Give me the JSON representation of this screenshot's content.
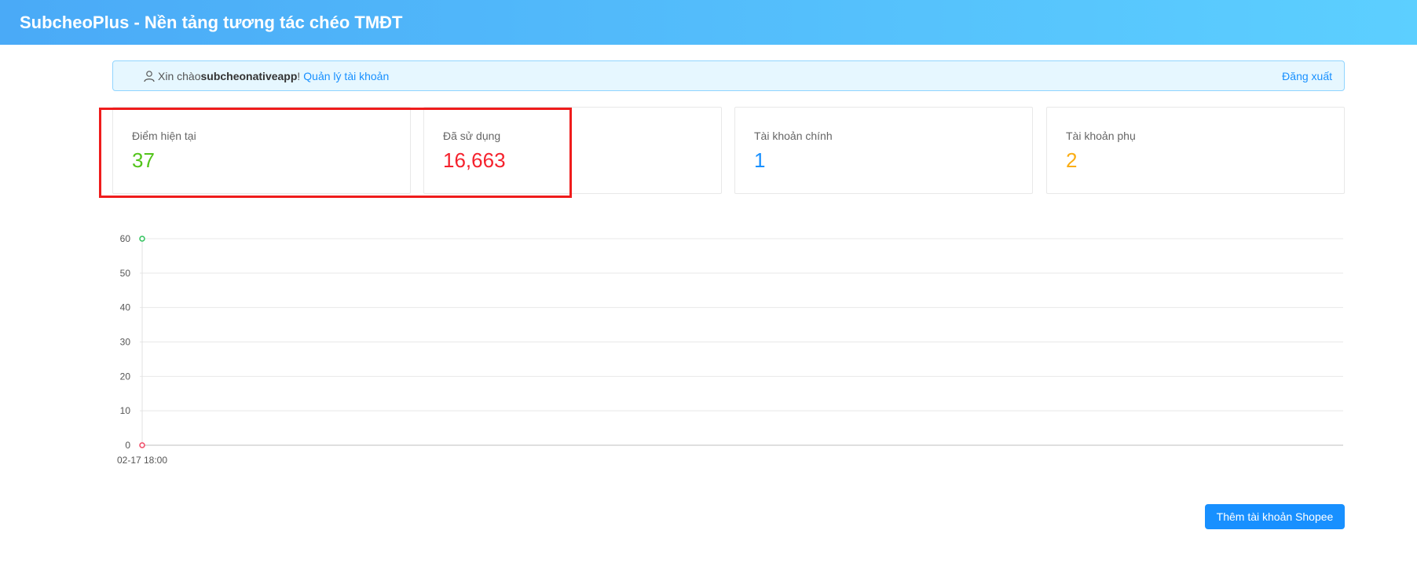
{
  "header": {
    "title": "SubcheoPlus - Nền tảng tương tác chéo TMĐT"
  },
  "welcome": {
    "greeting": "Xin chào ",
    "username": "subcheonativeapp",
    "exclaim": "!",
    "manage_link": "Quản lý tài khoản",
    "logout_link": "Đăng xuất"
  },
  "stats": {
    "current_points_label": "Điểm hiện tại",
    "current_points_value": "37",
    "used_label": "Đã sử dụng",
    "used_value": "16,663",
    "main_accounts_label": "Tài khoản chính",
    "main_accounts_value": "1",
    "sub_accounts_label": "Tài khoản phụ",
    "sub_accounts_value": "2"
  },
  "colors": {
    "header_start": "#4aaaf7",
    "header_end": "#5ccfff",
    "green": "#52c41a",
    "red": "#f5222d",
    "blue": "#1890ff",
    "orange": "#faad14",
    "highlight": "#ef1c1c"
  },
  "chart_data": {
    "type": "line",
    "x": [
      "02-17 18:00"
    ],
    "series": [
      {
        "values": [
          60
        ],
        "color": "#2fc25b"
      },
      {
        "values": [
          0
        ],
        "color": "#f04864"
      }
    ],
    "yticks": [
      0,
      10,
      20,
      30,
      40,
      50,
      60
    ],
    "ylim": [
      0,
      60
    ],
    "grid": true
  },
  "actions": {
    "add_shopee_label": "Thêm tài khoản Shopee"
  },
  "icons": {
    "user": "user-icon"
  }
}
